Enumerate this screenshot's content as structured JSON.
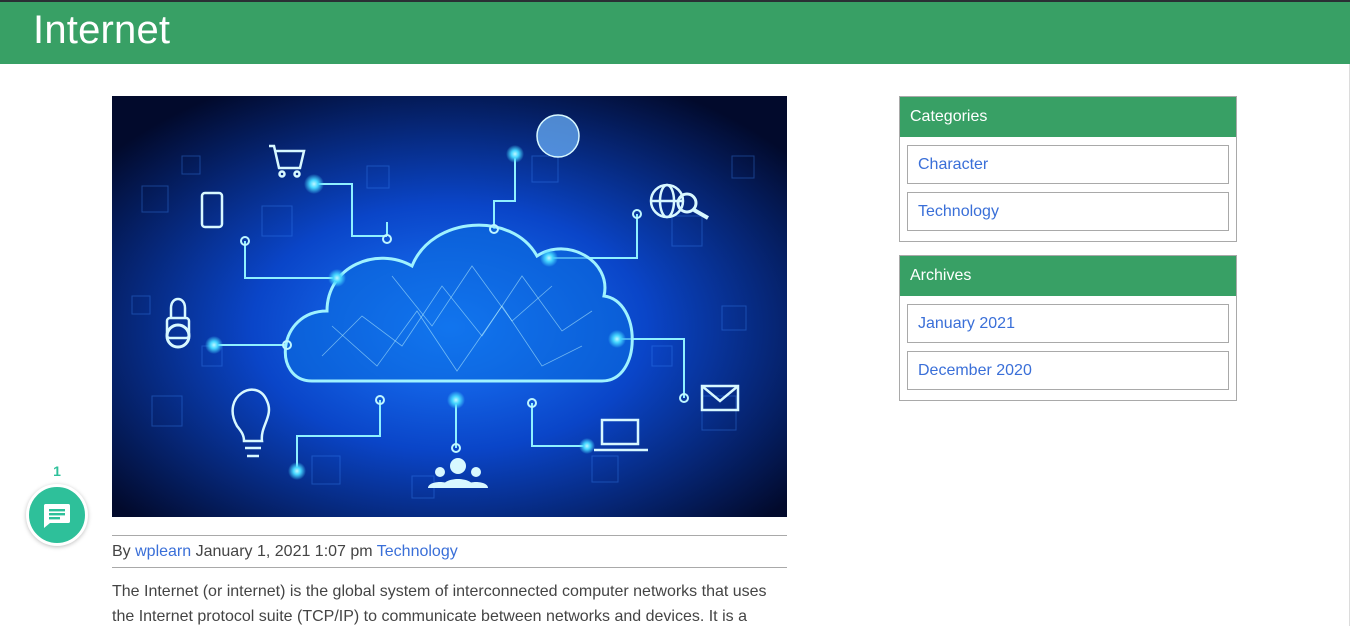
{
  "site": {
    "title": "Internet"
  },
  "post": {
    "image_alt": "cloud computing network illustration",
    "meta": {
      "by": "By",
      "author": "wplearn",
      "date": "January 1, 2021 1:07 pm",
      "category": "Technology"
    },
    "excerpt": "The Internet (or internet) is the global system of interconnected computer networks that uses the Internet protocol suite (TCP/IP) to communicate between networks and devices. It is a"
  },
  "sidebar": {
    "categories": {
      "title": "Categories",
      "items": [
        "Character",
        "Technology"
      ]
    },
    "archives": {
      "title": "Archives",
      "items": [
        "January 2021",
        "December 2020"
      ]
    }
  },
  "chat": {
    "count": "1",
    "icon": "chat-bubble-icon"
  },
  "colors": {
    "brand_green": "#38a065",
    "link": "#3a6fd8",
    "chat": "#2ec09a"
  }
}
